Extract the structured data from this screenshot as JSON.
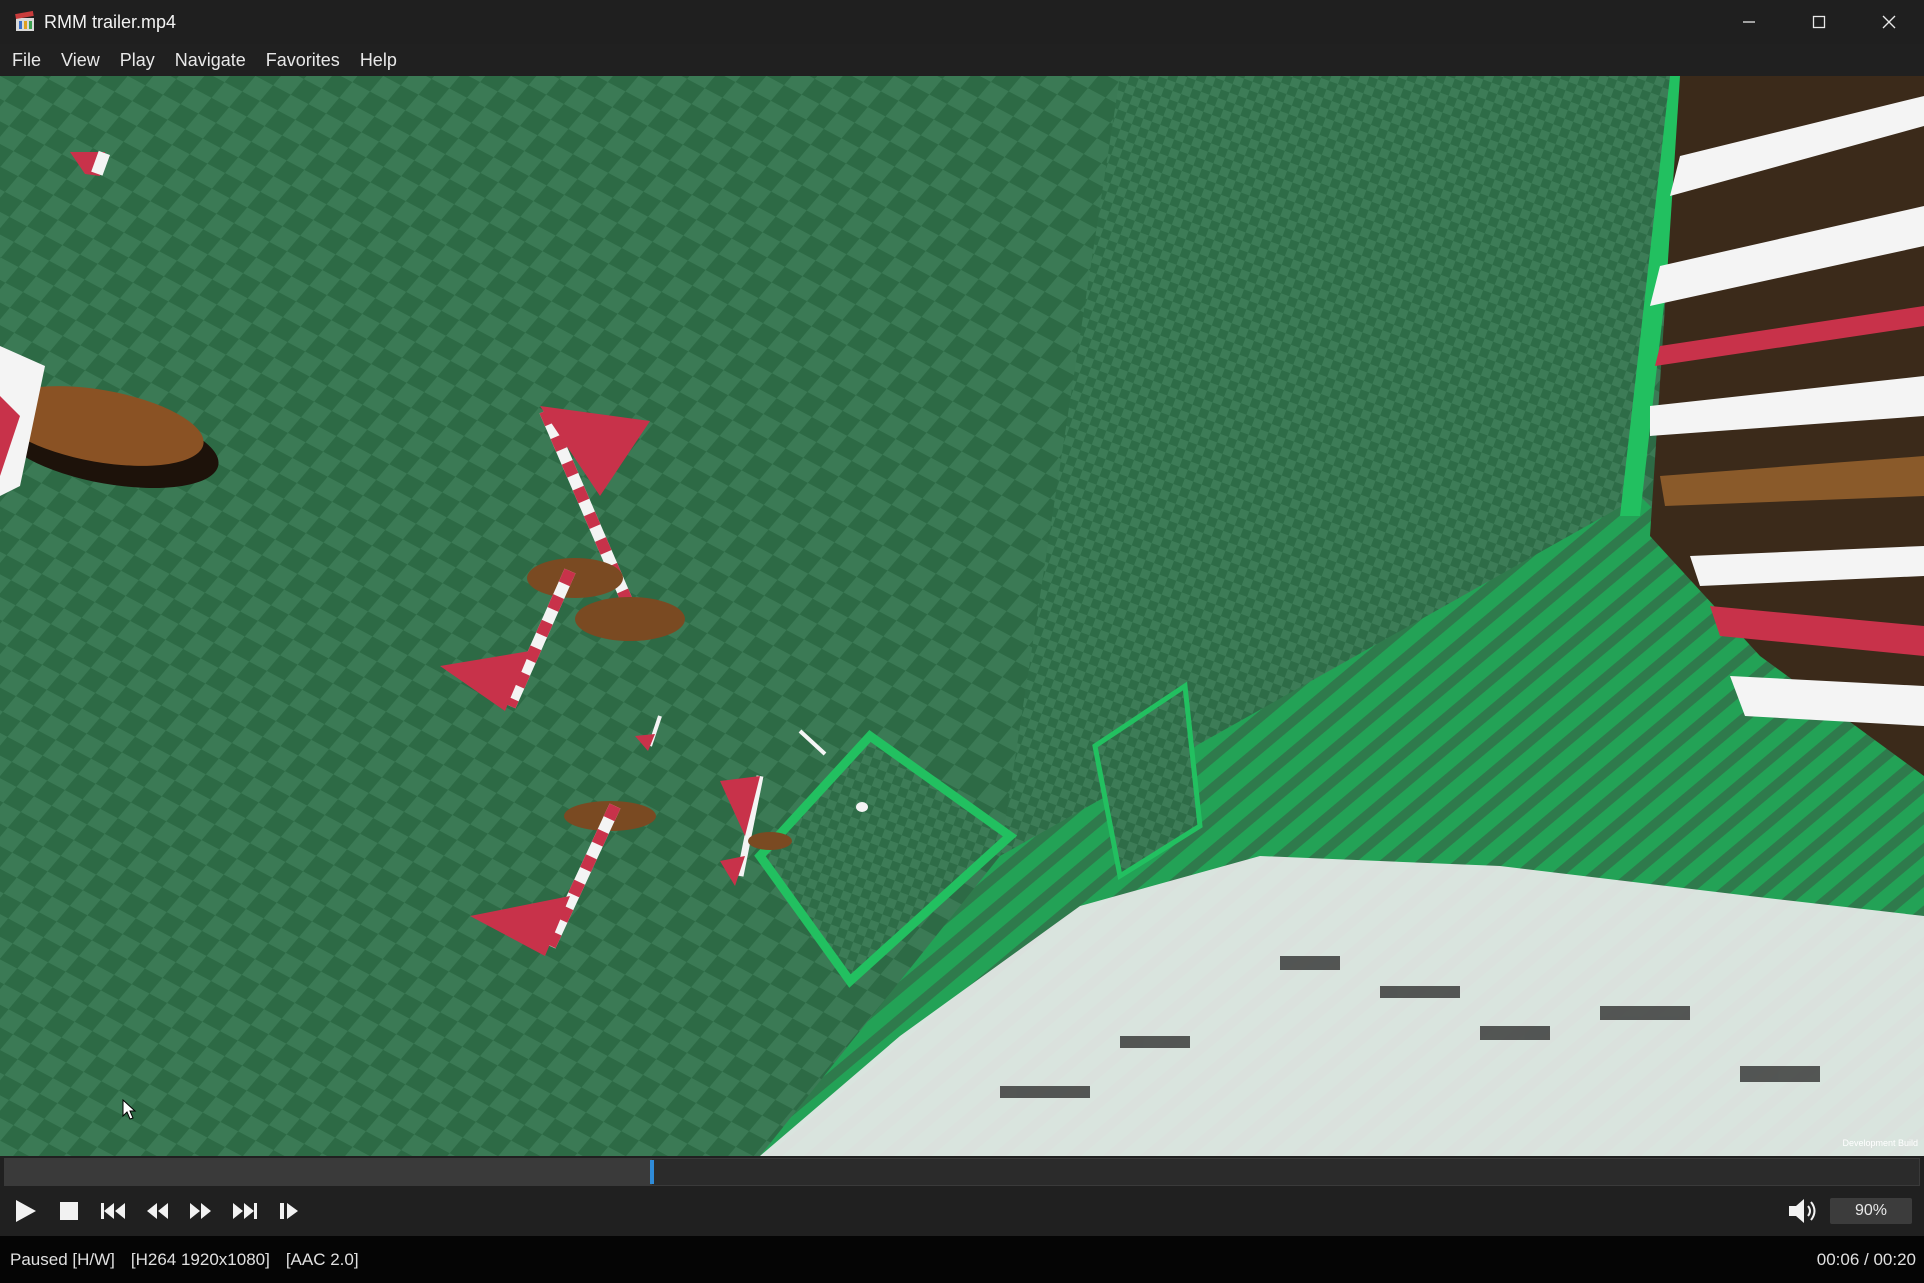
{
  "window": {
    "title": "RMM trailer.mp4",
    "app_icon": "clapperboard-icon",
    "controls": [
      "minimize-icon",
      "maximize-icon",
      "close-icon"
    ]
  },
  "menu": {
    "items": [
      {
        "label": "File"
      },
      {
        "label": "View"
      },
      {
        "label": "Play"
      },
      {
        "label": "Navigate"
      },
      {
        "label": "Favorites"
      },
      {
        "label": "Help"
      }
    ]
  },
  "video": {
    "watermark": "Development Build"
  },
  "seek": {
    "progress": 0.338
  },
  "controls": {
    "buttons": [
      "play-icon",
      "stop-icon",
      "skip-previous-icon",
      "rewind-icon",
      "fast-forward-icon",
      "skip-next-icon",
      "frame-step-icon"
    ],
    "volume_icon": "speaker-icon",
    "volume": "90%"
  },
  "status": {
    "state": "Paused [H/W]",
    "video_codec": "[H264 1920x1080]",
    "audio_codec": "[AAC 2.0]",
    "time": "00:06 / 00:20"
  },
  "colors": {
    "accent": "#2f8bd8",
    "checker_dark": "#2d6a45",
    "checker_light": "#3b7a55",
    "neon_green": "#22c060",
    "flag_red": "#c8324a"
  }
}
